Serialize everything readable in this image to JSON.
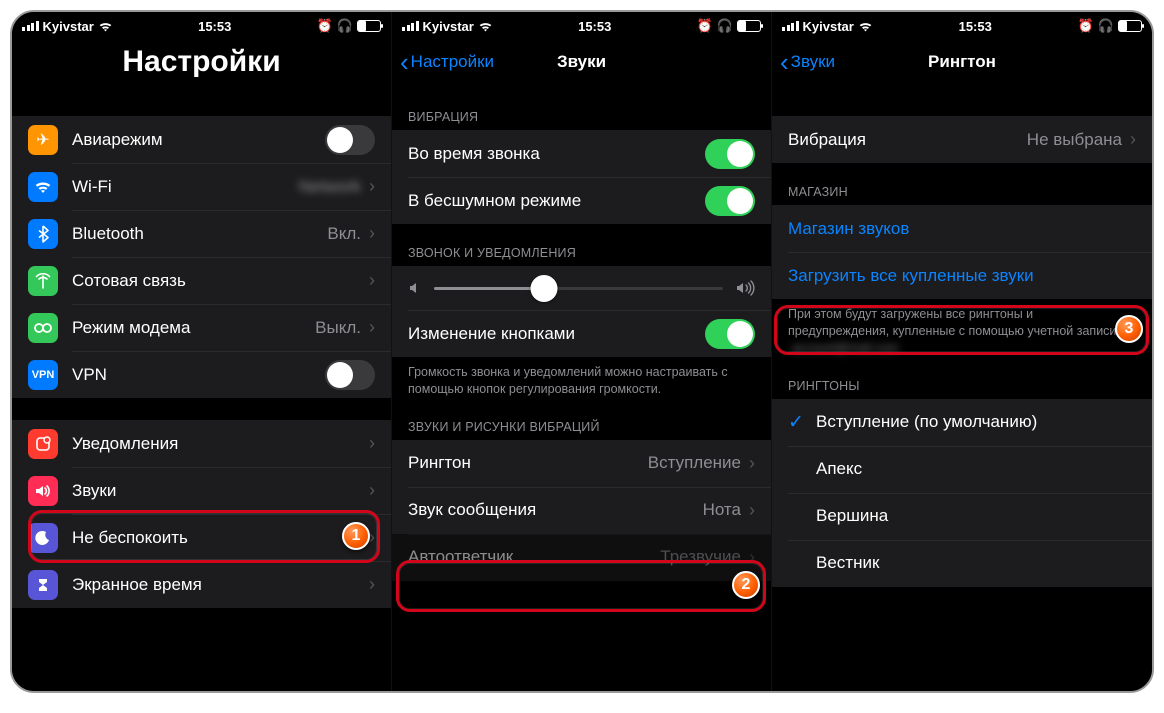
{
  "status": {
    "carrier": "Kyivstar",
    "time": "15:53"
  },
  "screen1": {
    "title": "Настройки",
    "airplane": "Авиарежим",
    "wifi": "Wi-Fi",
    "bluetooth": "Bluetooth",
    "bluetooth_value": "Вкл.",
    "cellular": "Сотовая связь",
    "hotspot": "Режим модема",
    "hotspot_value": "Выкл.",
    "vpn": "VPN",
    "notifications": "Уведомления",
    "sounds": "Звуки",
    "dnd": "Не беспокоить",
    "screentime": "Экранное время"
  },
  "screen2": {
    "back": "Настройки",
    "title": "Звуки",
    "sec_vibration": "ВИБРАЦИЯ",
    "vib_ring": "Во время звонка",
    "vib_silent": "В бесшумном режиме",
    "sec_ringer": "ЗВОНОК И УВЕДОМЛЕНИЯ",
    "change_buttons": "Изменение кнопками",
    "ringer_footer": "Громкость звонка и уведомлений можно настраивать с помощью кнопок регулирования громкости.",
    "sec_patterns": "ЗВУКИ И РИСУНКИ ВИБРАЦИЙ",
    "ringtone": "Рингтон",
    "ringtone_value": "Вступление",
    "texttone": "Звук сообщения",
    "texttone_value": "Нота",
    "voicemail": "Автоответчик",
    "voicemail_value": "Трезвучие",
    "slider_percent": 38
  },
  "screen3": {
    "back": "Звуки",
    "title": "Рингтон",
    "vibration_label": "Вибрация",
    "vibration_value": "Не выбрана",
    "sec_store": "МАГАЗИН",
    "tone_store": "Магазин звуков",
    "download_all": "Загрузить все купленные звуки",
    "store_footer": "При этом будут загружены все рингтоны и предупреждения, купленные с помощью учетной записи",
    "sec_ringtones": "РИНГТОНЫ",
    "tone_default": "Вступление (по умолчанию)",
    "tone_apex": "Апекс",
    "tone_vershina": "Вершина",
    "tone_vestnik": "Вестник"
  },
  "callouts": {
    "n1": "1",
    "n2": "2",
    "n3": "3"
  }
}
